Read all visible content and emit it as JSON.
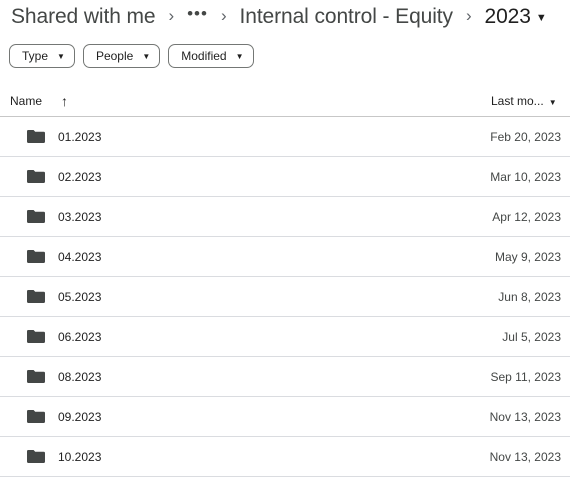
{
  "breadcrumb": {
    "root": "Shared with me",
    "separator": "›",
    "overflow": "•••",
    "middle": "Internal control - Equity",
    "current": "2023",
    "current_caret": "▼"
  },
  "filters": [
    {
      "label": "Type",
      "caret": "▼"
    },
    {
      "label": "People",
      "caret": "▼"
    },
    {
      "label": "Modified",
      "caret": "▼"
    }
  ],
  "table": {
    "name_header": "Name",
    "sort_arrow": "↑",
    "modified_header": "Last mo...",
    "modified_caret": "▼",
    "folder_icon_color": "#444746",
    "rows": [
      {
        "name": "01.2023",
        "date": "Feb 20, 2023",
        "icon": "folder-icon"
      },
      {
        "name": "02.2023",
        "date": "Mar 10, 2023",
        "icon": "folder-icon"
      },
      {
        "name": "03.2023",
        "date": "Apr 12, 2023",
        "icon": "folder-icon"
      },
      {
        "name": "04.2023",
        "date": "May 9, 2023",
        "icon": "folder-icon"
      },
      {
        "name": "05.2023",
        "date": "Jun 8, 2023",
        "icon": "folder-icon"
      },
      {
        "name": "06.2023",
        "date": "Jul 5, 2023",
        "icon": "folder-icon"
      },
      {
        "name": "08.2023",
        "date": "Sep 11, 2023",
        "icon": "folder-icon"
      },
      {
        "name": "09.2023",
        "date": "Nov 13, 2023",
        "icon": "folder-icon"
      },
      {
        "name": "10.2023",
        "date": "Nov 13, 2023",
        "icon": "folder-icon"
      }
    ]
  }
}
